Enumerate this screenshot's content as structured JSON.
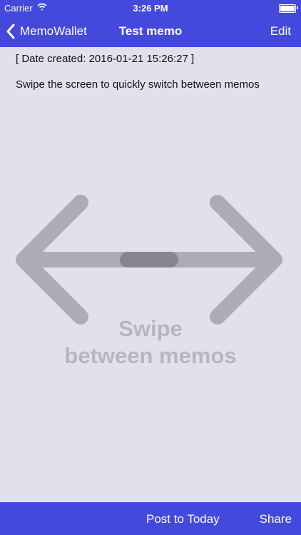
{
  "status_bar": {
    "carrier": "Carrier",
    "time": "3:26 PM"
  },
  "nav": {
    "back_label": "MemoWallet",
    "title": "Test memo",
    "edit_label": "Edit"
  },
  "memo": {
    "date_created": "[ Date created: 2016-01-21 15:26:27 ]",
    "text": "Swipe the screen to quickly switch between memos"
  },
  "swipe_hint": {
    "line1": "Swipe",
    "line2": "between memos"
  },
  "toolbar": {
    "post_today_label": "Post to Today",
    "share_label": "Share"
  },
  "colors": {
    "accent": "#4449de",
    "background": "#e1e1ed",
    "graphic": "#acacb4",
    "handle": "#86868e"
  },
  "icons": [
    "wifi-icon",
    "battery-icon",
    "back-chevron-icon",
    "double-arrow-icon"
  ]
}
